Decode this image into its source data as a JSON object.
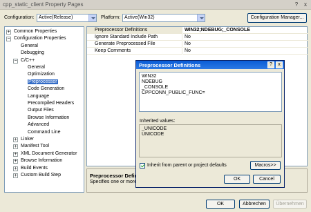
{
  "window": {
    "title": "cpp_static_client Property Pages",
    "help": "?",
    "close": "x"
  },
  "config": {
    "configuration_label": "Configuration:",
    "configuration_value": "Active(Release)",
    "platform_label": "Platform:",
    "platform_value": "Active(Win32)",
    "manager_button": "Configuration Manager..."
  },
  "tree": {
    "items": [
      {
        "label": "Common Properties",
        "exp": "+"
      },
      {
        "label": "Configuration Properties",
        "exp": "−"
      },
      {
        "label": "General",
        "exp": ""
      },
      {
        "label": "Debugging",
        "exp": ""
      },
      {
        "label": "C/C++",
        "exp": "−"
      },
      {
        "label": "General",
        "exp": ""
      },
      {
        "label": "Optimization",
        "exp": ""
      },
      {
        "label": "Preprocessor",
        "exp": ""
      },
      {
        "label": "Code Generation",
        "exp": ""
      },
      {
        "label": "Language",
        "exp": ""
      },
      {
        "label": "Precompiled Headers",
        "exp": ""
      },
      {
        "label": "Output Files",
        "exp": ""
      },
      {
        "label": "Browse Information",
        "exp": ""
      },
      {
        "label": "Advanced",
        "exp": ""
      },
      {
        "label": "Command Line",
        "exp": ""
      },
      {
        "label": "Linker",
        "exp": "+"
      },
      {
        "label": "Manifest Tool",
        "exp": "+"
      },
      {
        "label": "XML Document Generator",
        "exp": "+"
      },
      {
        "label": "Browse Information",
        "exp": "+"
      },
      {
        "label": "Build Events",
        "exp": "+"
      },
      {
        "label": "Custom Build Step",
        "exp": "+"
      }
    ]
  },
  "grid": {
    "rows": [
      {
        "name": "Preprocessor Definitions",
        "value": "WIN32;NDEBUG;_CONSOLE"
      },
      {
        "name": "Ignore Standard Include Path",
        "value": "No"
      },
      {
        "name": "Generate Preprocessed File",
        "value": "No"
      },
      {
        "name": "Keep Comments",
        "value": "No"
      }
    ]
  },
  "description": {
    "title": "Preprocessor Defini",
    "text": "Specifies one or more"
  },
  "modal": {
    "title": "Preprocessor Definitions",
    "help": "?",
    "close": "x",
    "definitions": [
      "WIN32",
      "NDEBUG",
      "_CONSOLE",
      "CPPCONN_PUBLIC_FUNC="
    ],
    "inherited_label": "Inherited values:",
    "inherited": [
      "_UNICODE",
      "UNICODE"
    ],
    "inherit_checkbox": "Inherit from parent or project defaults",
    "macros_button": "Macros>>",
    "ok_button": "OK",
    "cancel_button": "Cancel"
  },
  "footer": {
    "ok": "OK",
    "cancel": "Abbrechen",
    "apply": "Übernehmen"
  }
}
